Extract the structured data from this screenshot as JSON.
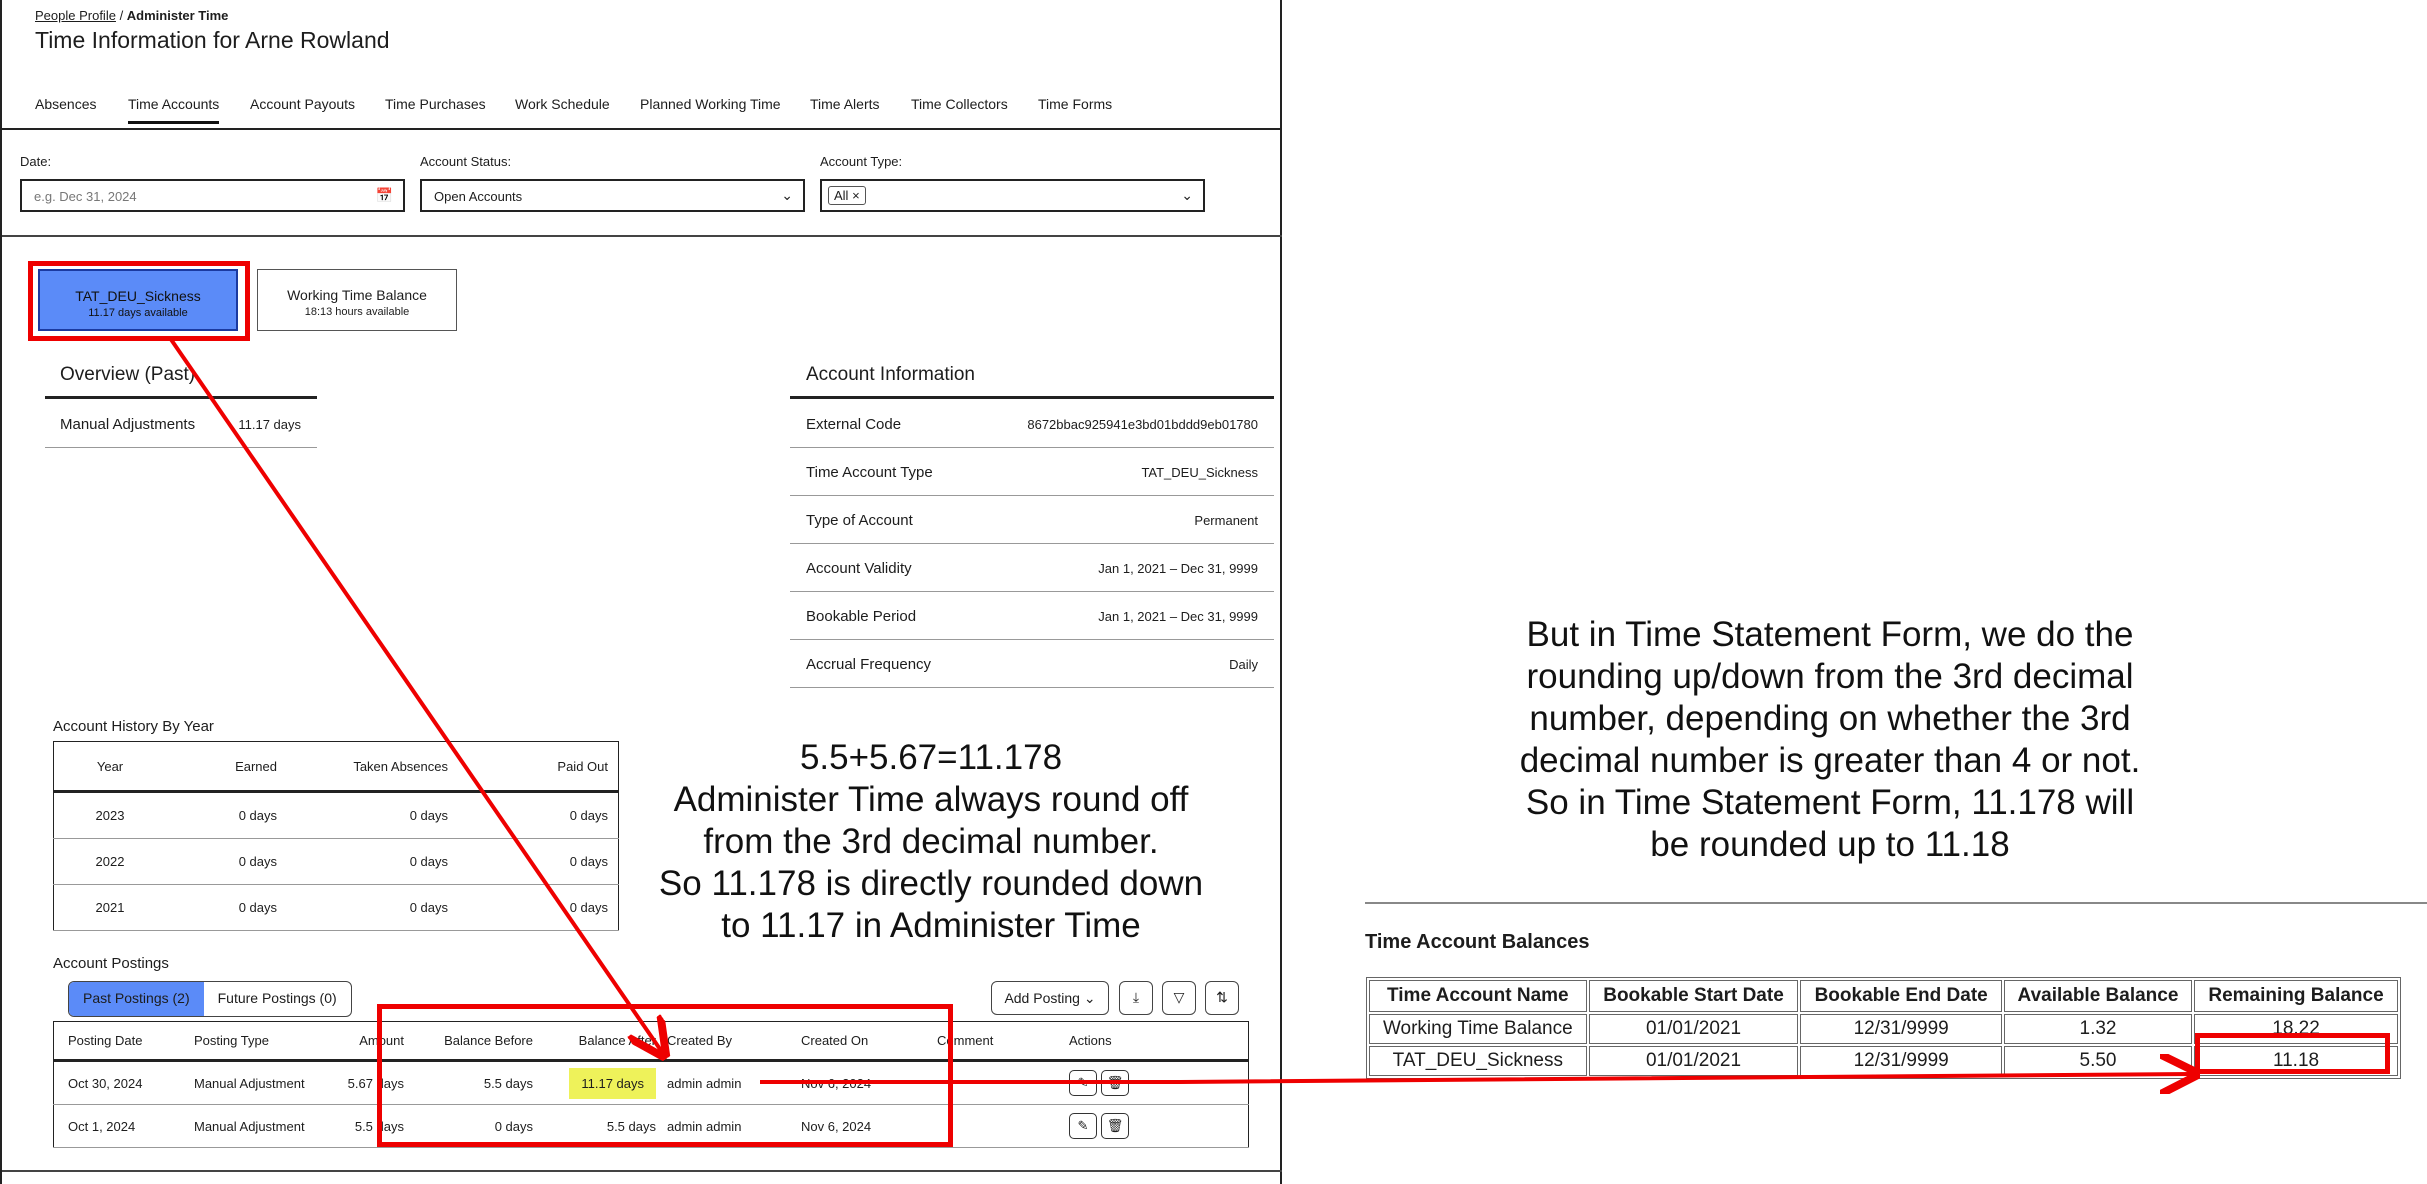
{
  "breadcrumb": {
    "link": "People Profile",
    "sep": " / ",
    "current": "Administer Time"
  },
  "page_title": "Time Information for Arne Rowland",
  "tabs": [
    "Absences",
    "Time Accounts",
    "Account Payouts",
    "Time Purchases",
    "Work Schedule",
    "Planned Working Time",
    "Time Alerts",
    "Time Collectors",
    "Time Forms"
  ],
  "active_tab": "Time Accounts",
  "filters": {
    "date_label": "Date:",
    "date_placeholder": "e.g. Dec 31, 2024",
    "status_label": "Account Status:",
    "status_value": "Open Accounts",
    "type_label": "Account Type:",
    "type_token": "All"
  },
  "accounts": [
    {
      "name": "TAT_DEU_Sickness",
      "sub": "11.17 days available",
      "selected": true
    },
    {
      "name": "Working Time Balance",
      "sub": "18:13 hours available",
      "selected": false
    }
  ],
  "overview": {
    "title": "Overview (Past)",
    "rows": [
      {
        "k": "Manual Adjustments",
        "v": "11.17 days"
      }
    ]
  },
  "account_info": {
    "title": "Account Information",
    "rows": [
      {
        "k": "External Code",
        "v": "8672bbac925941e3bd01bddd9eb01780"
      },
      {
        "k": "Time Account Type",
        "v": "TAT_DEU_Sickness"
      },
      {
        "k": "Type of Account",
        "v": "Permanent"
      },
      {
        "k": "Account Validity",
        "v": "Jan 1, 2021 – Dec 31, 9999"
      },
      {
        "k": "Bookable Period",
        "v": "Jan 1, 2021 – Dec 31, 9999"
      },
      {
        "k": "Accrual Frequency",
        "v": "Daily"
      }
    ]
  },
  "history": {
    "title": "Account History By Year",
    "headers": [
      "Year",
      "Earned",
      "Taken Absences",
      "Paid Out"
    ],
    "rows": [
      [
        "2023",
        "0 days",
        "0 days",
        "0 days"
      ],
      [
        "2022",
        "0 days",
        "0 days",
        "0 days"
      ],
      [
        "2021",
        "0 days",
        "0 days",
        "0 days"
      ]
    ]
  },
  "postings": {
    "title": "Account Postings",
    "seg_past": "Past Postings (2)",
    "seg_future": "Future Postings (0)",
    "add_button": "Add Posting",
    "headers": [
      "Posting Date",
      "Posting Type",
      "Amount",
      "Balance Before",
      "Balance After",
      "Created By",
      "Created On",
      "Comment",
      "Actions"
    ],
    "rows": [
      [
        "Oct 30, 2024",
        "Manual Adjustment",
        "5.67 days",
        "5.5 days",
        "11.17 days",
        "admin admin",
        "Nov 6, 2024",
        ""
      ],
      [
        "Oct 1, 2024",
        "Manual Adjustment",
        "5.5 days",
        "0 days",
        "5.5 days",
        "admin admin",
        "Nov 6, 2024",
        ""
      ]
    ]
  },
  "annotation_left": [
    "5.5+5.67=11.178",
    "Administer Time always round off",
    "from the 3rd decimal number.",
    "So 11.178 is directly rounded down",
    "to 11.17 in Administer Time"
  ],
  "annotation_right": [
    "But in Time Statement Form, we do the",
    "rounding up/down from the 3rd decimal",
    "number, depending on whether the 3rd",
    "decimal number is greater than 4 or not.",
    "So in Time Statement Form, 11.178 will",
    "be rounded up to 11.18"
  ],
  "tsf": {
    "title": "Time Account Balances",
    "headers": [
      "Time Account Name",
      "Bookable Start Date",
      "Bookable End Date",
      "Available Balance",
      "Remaining Balance"
    ],
    "rows": [
      [
        "Working Time Balance",
        "01/01/2021",
        "12/31/9999",
        "1.32",
        "18.22"
      ],
      [
        "TAT_DEU_Sickness",
        "01/01/2021",
        "12/31/9999",
        "5.50",
        "11.18"
      ]
    ]
  },
  "colors": {
    "selected": "#5b8bf8",
    "annotation": "#e00000",
    "highlight": "#eef25a"
  }
}
